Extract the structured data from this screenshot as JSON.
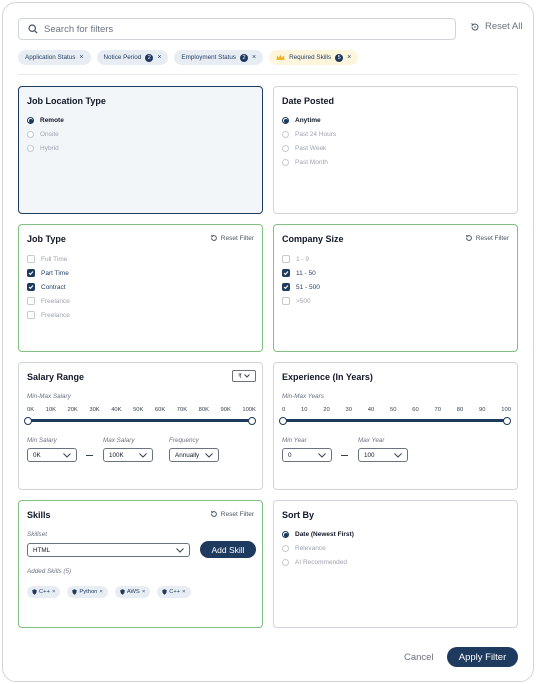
{
  "search": {
    "placeholder": "Search for filters",
    "reset_all": "Reset All"
  },
  "chips": [
    {
      "label": "Application Status",
      "count": "",
      "gold": false
    },
    {
      "label": "Notice Period",
      "count": "2",
      "gold": false
    },
    {
      "label": "Employment Status",
      "count": "2",
      "gold": false
    },
    {
      "label": "Required Skills",
      "count": "5",
      "gold": true
    }
  ],
  "job_location": {
    "title": "Job Location Type",
    "options": [
      "Remote",
      "Onsite",
      "Hybrid"
    ],
    "selected": "Remote"
  },
  "date_posted": {
    "title": "Date Posted",
    "options": [
      "Anytime",
      "Past 24 Hours",
      "Past Week",
      "Past Month"
    ],
    "selected": "Anytime"
  },
  "job_type": {
    "title": "Job Type",
    "reset": "Reset Filter",
    "options": [
      {
        "label": "Full Time",
        "checked": false
      },
      {
        "label": "Part Time",
        "checked": true
      },
      {
        "label": "Contract",
        "checked": true
      },
      {
        "label": "Freelance",
        "checked": false
      },
      {
        "label": "Freelance",
        "checked": false
      }
    ]
  },
  "company_size": {
    "title": "Company Size",
    "reset": "Reset Filter",
    "options": [
      {
        "label": "1 - 9",
        "checked": false
      },
      {
        "label": "11 - 50",
        "checked": true
      },
      {
        "label": "51 - 500",
        "checked": true
      },
      {
        "label": ">500",
        "checked": false
      }
    ]
  },
  "salary": {
    "title": "Salary Range",
    "currency": "₹",
    "range_label": "Min-Max Salary",
    "ticks": [
      "0K",
      "10K",
      "20K",
      "30K",
      "40K",
      "50K",
      "60K",
      "70K",
      "80K",
      "90K",
      "100K"
    ],
    "range": [
      0,
      100
    ],
    "min_label": "Min Salary",
    "min_value": "0K",
    "max_label": "Max Salary",
    "max_value": "100K",
    "freq_label": "Frequency",
    "freq_value": "Annually"
  },
  "experience": {
    "title": "Experience (In Years)",
    "range_label": "Min-Max Years",
    "ticks": [
      "0",
      "10",
      "20",
      "30",
      "40",
      "50",
      "60",
      "70",
      "80",
      "90",
      "100"
    ],
    "range": [
      0,
      100
    ],
    "min_label": "Min Year",
    "min_value": "0",
    "max_label": "Max Year",
    "max_value": "100"
  },
  "skills": {
    "title": "Skills",
    "reset": "Reset Filter",
    "skillset_label": "Skillset",
    "skillset_value": "HTML",
    "add_button": "Add Skill",
    "added_label": "Added Skills (5)",
    "added": [
      "C++",
      "Python",
      "AWS",
      "C++"
    ]
  },
  "sort_by": {
    "title": "Sort By",
    "options": [
      "Date (Newest First)",
      "Relevance",
      "AI Recommended"
    ],
    "selected": "Date (Newest First)"
  },
  "footer": {
    "cancel": "Cancel",
    "apply": "Apply Filter"
  },
  "colors": {
    "accent": "#1e3a5f",
    "active_border": "#7fbf7f",
    "chip_bg": "#e8edf4"
  }
}
